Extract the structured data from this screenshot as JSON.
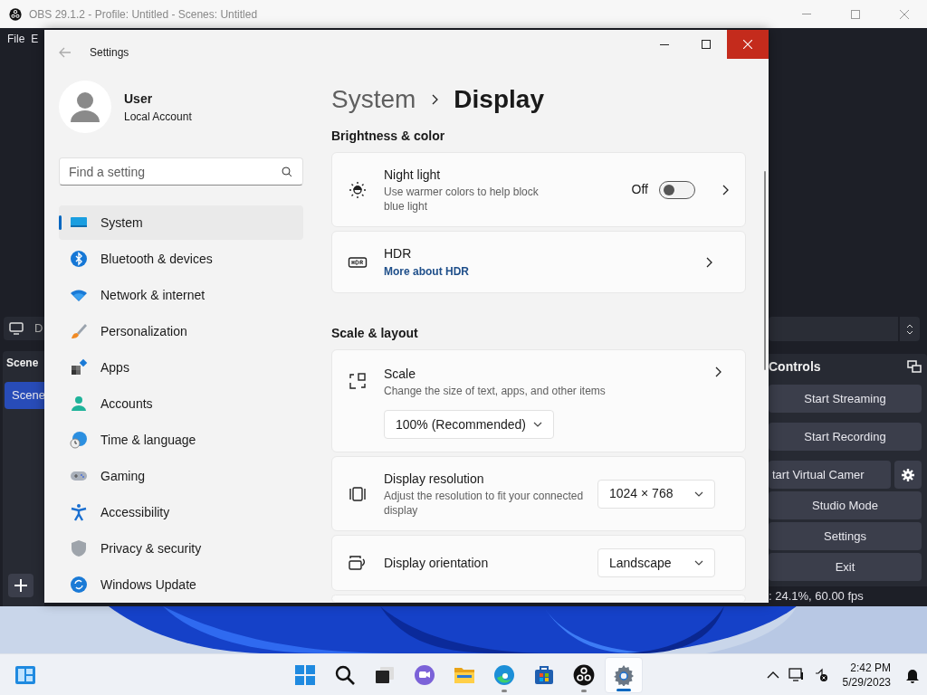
{
  "obs": {
    "title": "OBS 29.1.2 - Profile: Untitled - Scenes: Untitled",
    "menu": [
      "File",
      "E"
    ],
    "source_row": "D",
    "scenes_header": "Scene",
    "scenes": [
      {
        "label": "Scene",
        "selected": true
      }
    ],
    "controls_header": "Controls",
    "controls": [
      {
        "kind": "button",
        "label": "Start Streaming"
      },
      {
        "kind": "button",
        "label": "Start Recording"
      },
      {
        "kind": "split",
        "label": "tart Virtual Camer"
      },
      {
        "kind": "button",
        "label": "Studio Mode"
      },
      {
        "kind": "button",
        "label": "Settings"
      },
      {
        "kind": "button",
        "label": "Exit"
      }
    ],
    "status": ": 24.1%, 60.00 fps"
  },
  "settings": {
    "title": "Settings",
    "user": {
      "name": "User",
      "account": "Local Account"
    },
    "search": {
      "placeholder": "Find a setting"
    },
    "nav": [
      {
        "label": "System",
        "selected": true
      },
      {
        "label": "Bluetooth & devices",
        "selected": false
      },
      {
        "label": "Network & internet",
        "selected": false
      },
      {
        "label": "Personalization",
        "selected": false
      },
      {
        "label": "Apps",
        "selected": false
      },
      {
        "label": "Accounts",
        "selected": false
      },
      {
        "label": "Time & language",
        "selected": false
      },
      {
        "label": "Gaming",
        "selected": false
      },
      {
        "label": "Accessibility",
        "selected": false
      },
      {
        "label": "Privacy & security",
        "selected": false
      },
      {
        "label": "Windows Update",
        "selected": false
      }
    ],
    "breadcrumb": [
      "System",
      "Display"
    ],
    "sections": [
      {
        "heading": "Brightness & color",
        "cards": [
          {
            "kind": "toggle",
            "title": "Night light",
            "description": "Use warmer colors to help block blue light",
            "state_label": "Off",
            "on": false
          },
          {
            "kind": "link",
            "title": "HDR",
            "link": "More about HDR"
          }
        ]
      },
      {
        "heading": "Scale & layout",
        "cards": [
          {
            "kind": "dropdown_below",
            "title": "Scale",
            "description": "Change the size of text, apps, and other items",
            "value": "100% (Recommended)"
          },
          {
            "kind": "dropdown",
            "title": "Display resolution",
            "description": "Adjust the resolution to fit your connected display",
            "value": "1024 × 768"
          },
          {
            "kind": "dropdown",
            "title": "Display orientation",
            "value": "Landscape"
          }
        ]
      }
    ]
  },
  "taskbar": {
    "apps": [
      {
        "running": false,
        "active": false
      },
      {
        "running": false,
        "active": false
      },
      {
        "running": false,
        "active": false
      },
      {
        "running": false,
        "active": false
      },
      {
        "running": false,
        "active": false
      },
      {
        "running": true,
        "active": false
      },
      {
        "running": false,
        "active": false
      },
      {
        "running": true,
        "active": false
      },
      {
        "running": true,
        "active": true
      }
    ],
    "time": "2:42 PM",
    "date": "5/29/2023"
  }
}
